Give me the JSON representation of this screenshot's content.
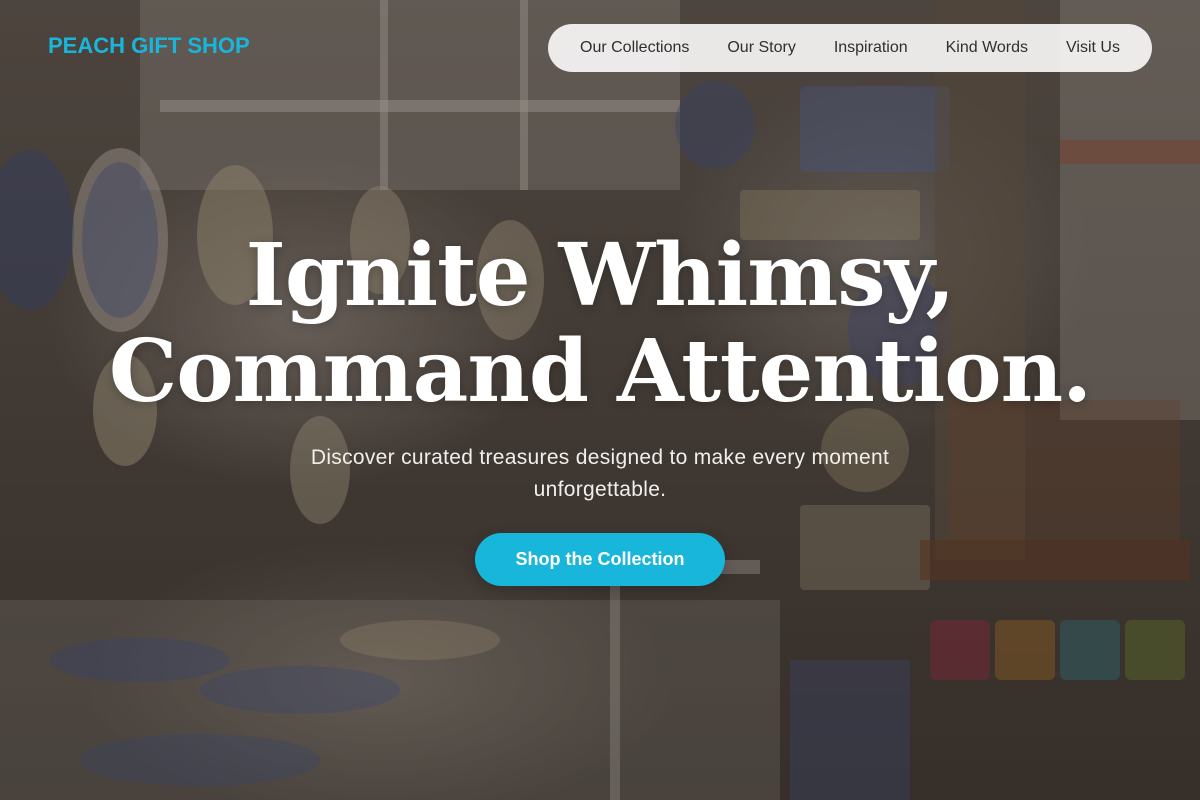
{
  "brand": {
    "name": "PEACH GIFT SHOP",
    "accent_color": "#19b6dc"
  },
  "nav": {
    "items": [
      {
        "label": "Our Collections"
      },
      {
        "label": "Our Story"
      },
      {
        "label": "Inspiration"
      },
      {
        "label": "Kind Words"
      },
      {
        "label": "Visit Us"
      }
    ]
  },
  "hero": {
    "title_line_1": "Ignite Whimsy,",
    "title_line_2": "Command Attention.",
    "subtitle": "Discover curated treasures designed to make every moment unforgettable.",
    "cta_label": "Shop the Collection",
    "background_image": "ceramic-shop-photo"
  }
}
